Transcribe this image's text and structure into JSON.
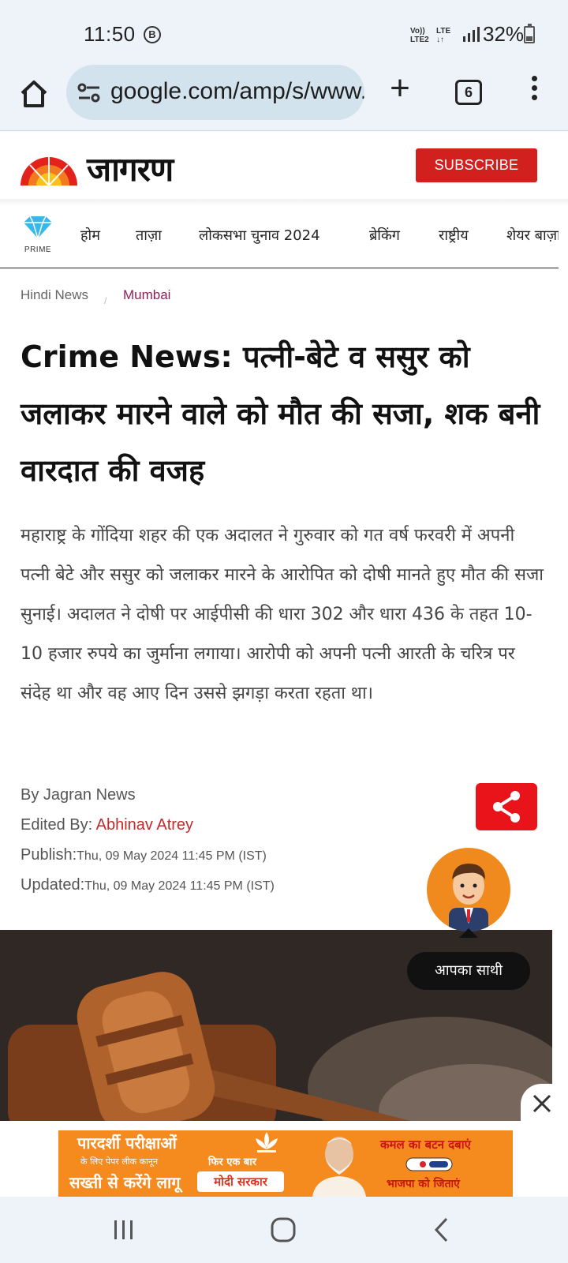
{
  "status_bar": {
    "time": "11:50",
    "notif_badge": "B",
    "network_top": "Vo))",
    "network_bottom": "LTE2",
    "lte": "LTE",
    "lte_arrows": "↓↑",
    "battery": "32%"
  },
  "browser": {
    "url": "google.com/amp/s/www.jagran.com",
    "tab_count": "6",
    "icons": [
      "home-icon",
      "site-settings-icon",
      "plus-icon",
      "tabs-icon",
      "more-vert-icon"
    ]
  },
  "site": {
    "logo_text": "जागरण",
    "subscribe_label": "SUBSCRIBE",
    "brand_color": "#d1201e"
  },
  "nav": {
    "prime_label": "PRIME",
    "items": [
      {
        "label": "होम"
      },
      {
        "label": "ताज़ा"
      },
      {
        "label": "लोकसभा चुनाव 2024"
      },
      {
        "label": "ब्रेकिंग"
      },
      {
        "label": "राष्ट्रीय"
      },
      {
        "label": "शेयर बाज़ार"
      }
    ]
  },
  "breadcrumb": {
    "home": "Hindi News",
    "separator": "/",
    "city": "Mumbai"
  },
  "article": {
    "headline": "Crime News: पत्नी-बेटे व ससुर को जलाकर मारने वाले को मौत की सजा, शक बनी वारदात की वजह",
    "summary": "महाराष्ट्र के गोंदिया शहर की एक अदालत ने गुरुवार को गत वर्ष फरवरी में अपनी पत्नी बेटे और ससुर को जलाकर मारने के आरोपित को दोषी मानते हुए मौत की सजा सुनाई। अदालत ने दोषी पर आईपीसी की धारा 302 और धारा 436 के तहत 10-10 हजार रुपये का जुर्माना लगाया। आरोपी को अपनी पत्नी आरती के चरित्र पर संदेह था और वह आए दिन उससे झगड़ा करता रहता था।",
    "byline": "By Jagran News",
    "edited_by_label": "Edited By: ",
    "editor": "Abhinav Atrey",
    "publish_label": "Publish:",
    "publish_date": "Thu, 09 May 2024 11:45 PM (IST)",
    "updated_label": "Updated:",
    "updated_date": "Thu, 09 May 2024 11:45 PM (IST)"
  },
  "assistant": {
    "label": "आपका साथी"
  },
  "ad": {
    "left_line1": "पारदर्शी परीक्षाओं",
    "left_line2": "के लिए पेपर लीक कानून",
    "left_line3": "सख्ती से करेंगे लागू",
    "mid_line1": "फिर एक बार",
    "mid_line2": "मोदी सरकार",
    "right_line1": "कमल का बटन दबाएं",
    "right_line2": "भाजपा को जिताएं"
  }
}
